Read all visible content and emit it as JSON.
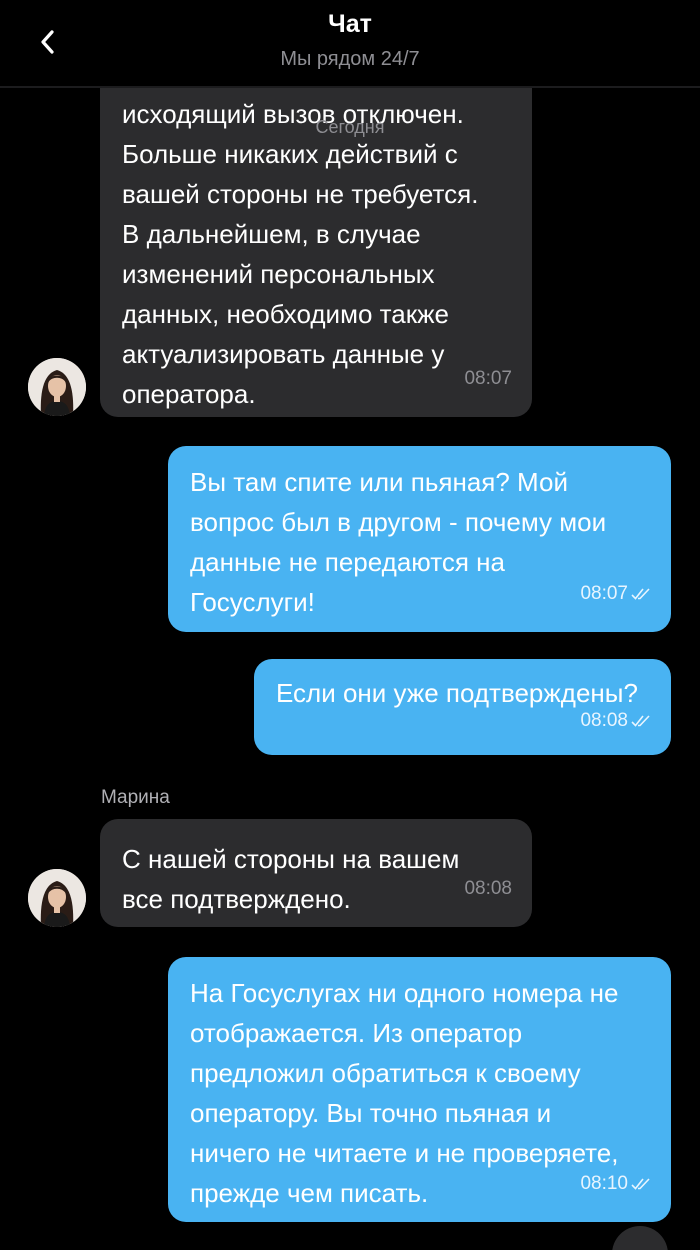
{
  "header": {
    "title": "Чат",
    "subtitle": "Мы рядом 24/7"
  },
  "date_separator": "Сегодня",
  "messages": [
    {
      "direction": "incoming",
      "text": "исходящий вызов отключен.\nБольше никаких действий с\nвашей стороны не требуется.\nВ дальнейшем, в случае\nизменений персональных\nданных, необходимо также\nактуализировать данные у\nоператора.",
      "time": "08:07"
    },
    {
      "direction": "outgoing",
      "text": "Вы там спите или пьяная? Мой\nвопрос был в другом - почему мои\nданные не передаются на\nГосуслуги!",
      "time": "08:07",
      "status": "read"
    },
    {
      "direction": "outgoing",
      "text": "Если они уже подтверждены?",
      "time": "08:08",
      "status": "read"
    },
    {
      "direction": "incoming",
      "sender": "Марина",
      "text": "С нашей стороны на вашем\nвсе подтверждено.",
      "time": "08:08"
    },
    {
      "direction": "outgoing",
      "text": "На Госуслугах ни одного номера не\nотображается. Из оператор\nпредложил обратиться к своему\nоператору. Вы точно пьяная и\nничего не читаете и не проверяете,\nпрежде чем писать.",
      "time": "08:10",
      "status": "read"
    }
  ],
  "icons": {
    "back": "chevron-left-icon",
    "read_status": "double-check-icon",
    "avatar": "operator-avatar"
  },
  "colors": {
    "background": "#000000",
    "incoming_bubble": "#2c2c2e",
    "outgoing_bubble": "#49b3f2",
    "secondary_text": "#8e8e93"
  }
}
